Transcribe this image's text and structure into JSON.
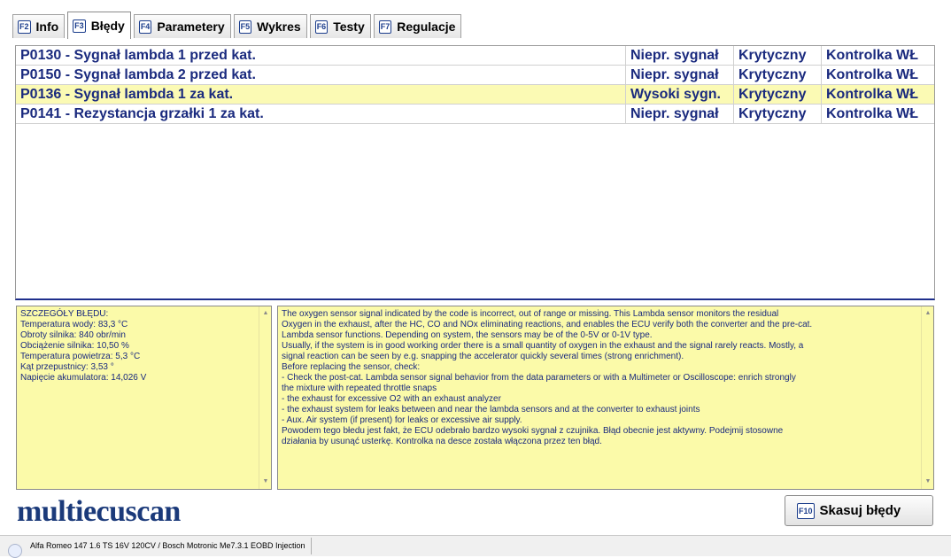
{
  "tabs": [
    {
      "key": "F2",
      "label": "Info",
      "active": false
    },
    {
      "key": "F3",
      "label": "Błędy",
      "active": true
    },
    {
      "key": "F4",
      "label": "Parametery",
      "active": false
    },
    {
      "key": "F5",
      "label": "Wykres",
      "active": false
    },
    {
      "key": "F6",
      "label": "Testy",
      "active": false
    },
    {
      "key": "F7",
      "label": "Regulacje",
      "active": false
    }
  ],
  "errors": [
    {
      "code_desc": "P0130 - Sygnał lambda 1 przed kat.",
      "type": "Niepr. sygnał",
      "severity": "Krytyczny",
      "mil": "Kontrolka WŁ",
      "selected": false
    },
    {
      "code_desc": "P0150 - Sygnał lambda 2 przed kat.",
      "type": "Niepr. sygnał",
      "severity": "Krytyczny",
      "mil": "Kontrolka WŁ",
      "selected": false
    },
    {
      "code_desc": "P0136 - Sygnał lambda 1 za kat.",
      "type": "Wysoki sygn.",
      "severity": "Krytyczny",
      "mil": "Kontrolka WŁ",
      "selected": true
    },
    {
      "code_desc": "P0141 - Rezystancja grzałki 1 za kat.",
      "type": "Niepr. sygnał",
      "severity": "Krytyczny",
      "mil": "Kontrolka WŁ",
      "selected": false
    }
  ],
  "details": {
    "text": "SZCZEGÓŁY BŁĘDU:\nTemperatura wody: 83,3 °C\nObroty silnika: 840 obr/min\nObciążenie silnika: 10,50 %\nTemperatura powietrza: 5,3 °C\nKąt przepustnicy: 3,53 °\nNapięcie akumulatora: 14,026 V"
  },
  "description": {
    "text": "The oxygen sensor signal indicated by the code is incorrect, out of range or missing. This Lambda sensor monitors the residual\nOxygen in the exhaust, after the HC, CO and NOx eliminating reactions, and enables the ECU verify both the converter and the pre-cat.\nLambda sensor functions. Depending on system, the sensors may be of the 0-5V or 0-1V type.\nUsually, if the system is in good working order there is a small quantity of oxygen in the exhaust and the signal rarely reacts. Mostly, a\nsignal reaction can be seen by e.g. snapping the accelerator quickly several times (strong enrichment).\nBefore replacing the sensor, check:\n- Check the post-cat. Lambda sensor signal behavior from the data parameters or with a Multimeter or Oscilloscope: enrich strongly\nthe mixture with repeated throttle snaps\n- the exhaust for excessive O2 with an exhaust analyzer\n- the exhaust system for leaks between and near the lambda sensors and at the converter to exhaust joints\n- Aux. Air system (if present) for leaks or excessive air supply.\nPowodem tego błedu jest fakt, że ECU odebrało bardzo wysoki sygnał z czujnika. Błąd obecnie jest aktywny. Podejmij stosowne\ndziałania by usunąć usterkę. Kontrolka na desce została włączona przez ten błąd."
  },
  "logo": {
    "text": "multiecuscan"
  },
  "clear_button": {
    "key": "F10",
    "label": "Skasuj błędy"
  },
  "status_bar": {
    "vehicle": "Alfa Romeo 147 1.6 TS 16V 120CV / Bosch Motronic Me7.3.1 EOBD Injection"
  }
}
